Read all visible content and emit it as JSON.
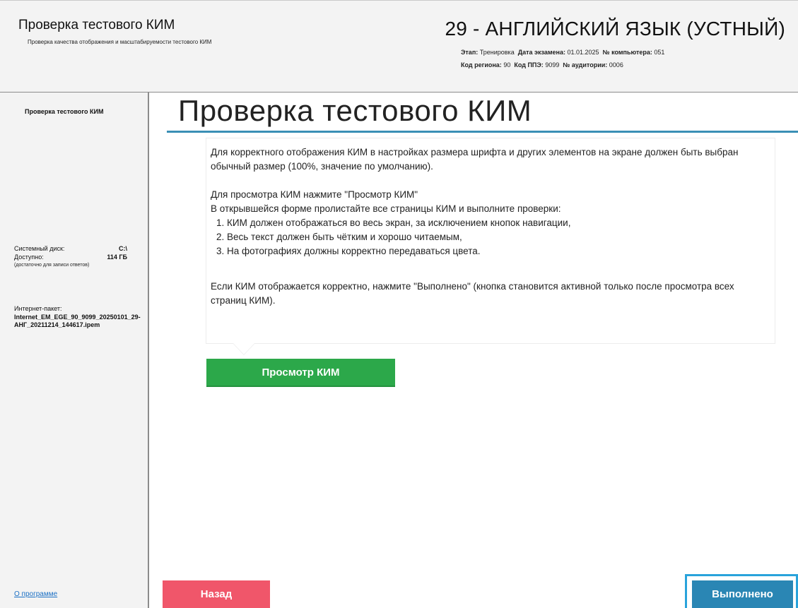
{
  "header": {
    "title": "Проверка тестового КИМ",
    "subtitle": "Проверка качества отображения и масштабируемости тестового КИМ",
    "exam_title": "29 - АНГЛИЙСКИЙ ЯЗЫК (УСТНЫЙ)",
    "meta": {
      "stage_label": "Этап:",
      "stage_value": "Тренировка",
      "date_label": "Дата экзамена:",
      "date_value": "01.01.2025",
      "computer_label": "№ компьютера:",
      "computer_value": "051",
      "region_label": "Код региона:",
      "region_value": "90",
      "ppe_label": "Код ППЭ:",
      "ppe_value": "9099",
      "room_label": "№ аудитории:",
      "room_value": "0006"
    }
  },
  "sidebar": {
    "title": "Проверка тестового КИМ",
    "system_disk_label": "Системный диск:",
    "system_disk_value": "C:\\",
    "available_label": "Доступно:",
    "available_value": "114 ГБ",
    "available_note": "(достаточно для записи ответов)",
    "package_label": "Интернет-пакет:",
    "package_name": "Internet_EM_EGE_90_9099_20250101_29-АНГ_20211214_144617.ipem",
    "about_link": "О программе"
  },
  "main": {
    "title": "Проверка тестового КИМ",
    "paragraph_1": " Для корректного отображения КИМ в настройках размера шрифта и других элементов на экране должен быть выбран обычный размер (100%, значение по умолчанию).",
    "paragraph_2_intro": " Для просмотра КИМ нажмите \"Просмотр КИМ\"",
    "paragraph_2_lead": "В открывшейся форме пролистайте все страницы КИМ и выполните проверки:",
    "checks": [
      "1. КИМ должен отображаться во весь экран, за исключением кнопок навигации,",
      "2. Весь текст должен быть чётким и хорошо читаемым,",
      "3. На фотографиях должны корректно передаваться цвета."
    ],
    "paragraph_3": " Если КИМ отображается корректно, нажмите \"Выполнено\" (кнопка становится активной только после просмотра всех страниц КИМ).",
    "view_button": "Просмотр КИМ"
  },
  "footer": {
    "back_button": "Назад",
    "done_button": "Выполнено"
  },
  "colors": {
    "accent_rule": "#3a8fb5",
    "view_button": "#2ca84a",
    "back_button": "#f0566a",
    "done_button": "#2a86b4",
    "focus_ring": "#29a3db"
  }
}
